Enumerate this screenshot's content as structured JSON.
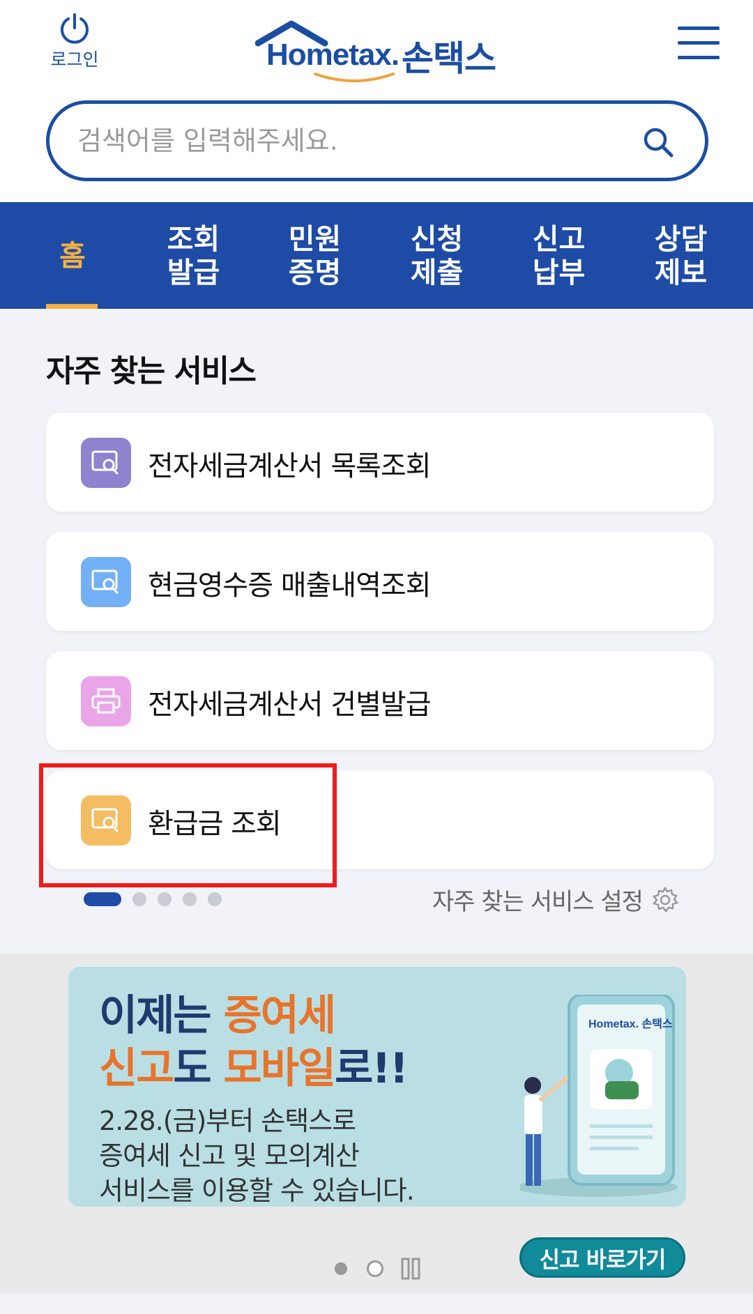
{
  "header": {
    "login_label": "로그인",
    "logo_en": "Hometax.",
    "logo_ko": "손택스"
  },
  "search": {
    "placeholder": "검색어를 입력해주세요."
  },
  "nav": {
    "items": [
      {
        "label": "홈",
        "active": true
      },
      {
        "label": "조회\n발급"
      },
      {
        "label": "민원\n증명"
      },
      {
        "label": "신청\n제출"
      },
      {
        "label": "신고\n납부"
      },
      {
        "label": "상담\n제보"
      }
    ],
    "active_color": "#f5b043",
    "bg_color": "#1e4ba5"
  },
  "frequent": {
    "title": "자주 찾는 서비스",
    "items": [
      {
        "label": "전자세금계산서 목록조회",
        "icon": "search-document-icon",
        "color": "#8f82cf"
      },
      {
        "label": "현금영수증 매출내역조회",
        "icon": "search-document-icon",
        "color": "#74b0f7"
      },
      {
        "label": "전자세금계산서 건별발급",
        "icon": "printer-icon",
        "color": "#eaa5e8"
      },
      {
        "label": "환급금 조회",
        "icon": "search-document-icon",
        "color": "#f5bd63"
      }
    ],
    "settings_label": "자주 찾는 서비스 설정",
    "page_count": 5,
    "active_page": 1
  },
  "banner": {
    "headline_1a": "이제는 ",
    "headline_1b": "증여세",
    "headline_2a": "신고",
    "headline_2b": "도 ",
    "headline_2c": "모바일",
    "headline_2d": "로!!",
    "desc_1": "2.28.(금)부터 손택스로",
    "desc_2": "증여세 신고 및 모의계산",
    "desc_3": "서비스를 이용할 수 있습니다.",
    "phone_logo": "Hometax. 손택스",
    "button_label": "신고 바로가기"
  }
}
